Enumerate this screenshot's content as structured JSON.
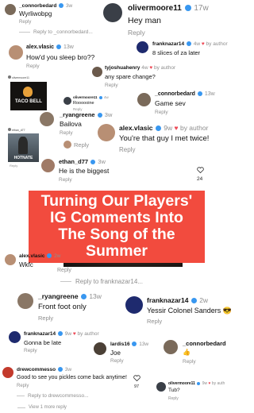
{
  "c1": {
    "user": "_connorbedard",
    "meta": "3w",
    "text": "Wyrliwobpg",
    "reply": "Reply",
    "view": "Reply to _connorbedard..."
  },
  "c2": {
    "user": "olivermoore11",
    "meta": "17w",
    "text": "Hey man",
    "reply": "Reply"
  },
  "c3": {
    "user": "franknazar14",
    "meta": "4w",
    "author": "by author",
    "text": "8 slices of za later"
  },
  "c4": {
    "user": "alex.vlasic",
    "meta": "13w",
    "text": "How'd you sleep bro??",
    "reply": "Reply"
  },
  "c5": {
    "user": "tyjoshuahenry",
    "meta": "4w",
    "author": "by author",
    "text": "any spare change?",
    "reply": "Reply"
  },
  "c6": {
    "user": "olivermoore11",
    "meta": "4w",
    "text": "Roooooine",
    "reply": "Reply"
  },
  "c7": {
    "user": "_connorbedard",
    "meta": "13w",
    "text": "Game sev",
    "reply": "Reply"
  },
  "c8": {
    "user": "_ryangreene",
    "meta": "3w",
    "text": "Bailova",
    "reply": "Reply"
  },
  "c9": {
    "user": "alex.vlasic",
    "meta": "9w",
    "author": "by author",
    "text": "You're that guy I met twice!",
    "reply": "Reply"
  },
  "c10": {
    "user": "ethan_d77",
    "meta": "3w",
    "text": "He is the biggest",
    "reply": "Reply",
    "likes": "24"
  },
  "banner": {
    "line1": "Turning Our Players'",
    "line2": "IG Comments Into",
    "line3": "The Song of the Summer"
  },
  "c11": {
    "user": "alex.vlasic",
    "meta": "2w",
    "text": "Wkfc",
    "reply": "Reply",
    "view": "Reply to franknazar14..."
  },
  "c12": {
    "user": "_ryangreene",
    "meta": "13w",
    "text": "Front foot only",
    "reply": "Reply"
  },
  "c13": {
    "user": "franknazar14",
    "meta": "2w",
    "text": "Yessir Colonel Sanders 😎",
    "reply": "Reply"
  },
  "c14": {
    "user": "franknazar14",
    "meta": "9w",
    "author": "by author",
    "text": "Gonna be late",
    "reply": "Reply"
  },
  "c15": {
    "user": "lardis16",
    "meta": "13w",
    "text": "Joe",
    "reply": "Reply"
  },
  "c16": {
    "user": "_connorbedard",
    "text": "👍",
    "reply": "Reply"
  },
  "c17": {
    "user": "drewcommesso",
    "meta": "3w",
    "text": "Good to see you pickles come back anytime!",
    "reply": "Reply",
    "likes": "97",
    "view": "Reply to drewcommesso..."
  },
  "c18": {
    "user": "olivermoore11",
    "meta": "9w",
    "author": "by auth",
    "text": "Tub?",
    "reply": "Reply"
  },
  "more": {
    "label": "View 1 more reply"
  },
  "thumbs": {
    "tacobell": "TACO BELL",
    "hotnate": "HOTNATE"
  },
  "colors": {
    "accent": "#f24b3e",
    "verified": "#3897f0",
    "heart": "#ed4956"
  }
}
